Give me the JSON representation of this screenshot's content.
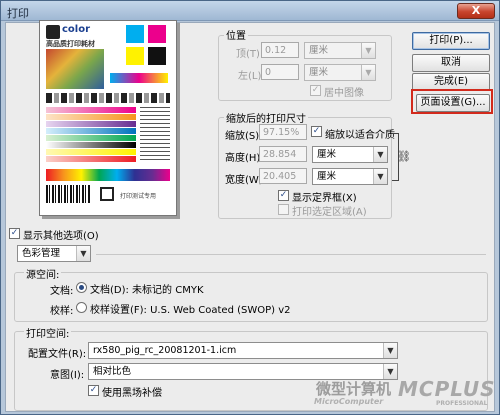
{
  "window": {
    "title": "打印",
    "close_label": "X"
  },
  "buttons": {
    "print": "打印(P)...",
    "cancel": "取消",
    "done": "完成(E)",
    "page_setup": "页面设置(G)..."
  },
  "position": {
    "group_label": "位置",
    "top_label": "顶(T):",
    "top_value": "0.12",
    "top_unit": "厘米",
    "left_label": "左(L):",
    "left_value": "0",
    "left_unit": "厘米",
    "center_image": "居中图像"
  },
  "scaled_size": {
    "group_label": "缩放后的打印尺寸",
    "scale_label": "缩放(S):",
    "scale_value": "97.15%",
    "fit_media": "缩放以适合介质",
    "height_label": "高度(H):",
    "height_value": "28.854",
    "height_unit": "厘米",
    "width_label": "宽度(W):",
    "width_value": "20.405",
    "width_unit": "厘米",
    "show_bounding_box": "显示定界框(X)",
    "print_selected_area": "打印选定区域(A)"
  },
  "preview": {
    "brand_text": "color",
    "subtitle": "高品质打印耗材",
    "caption": "打印测试专用"
  },
  "more_options": {
    "label": "显示其他选项(O)",
    "dropdown_value": "色彩管理"
  },
  "source_space": {
    "group_label": "源空间:",
    "document_label": "文档:",
    "document_option": "文档(D): 未标记的 CMYK",
    "proof_label": "校样:",
    "proof_option": "校样设置(F): U.S. Web Coated (SWOP) v2"
  },
  "print_space": {
    "group_label": "打印空间:",
    "profile_label": "配置文件(R):",
    "profile_value": "rx580_pig_rc_20081201-1.icm",
    "intent_label": "意图(I):",
    "intent_value": "相对比色",
    "black_point": "使用黑场补偿"
  },
  "watermark": {
    "cn": "微型计算机",
    "en": "MicroComputer",
    "logo": "MCPLUS",
    "logo_sub": "PROFESSIONAL"
  },
  "colors": {
    "title_bar": "#a9c0da",
    "close_button": "#c8442d",
    "highlight": "#d22a1c",
    "dialog_bg": "#ececec"
  }
}
